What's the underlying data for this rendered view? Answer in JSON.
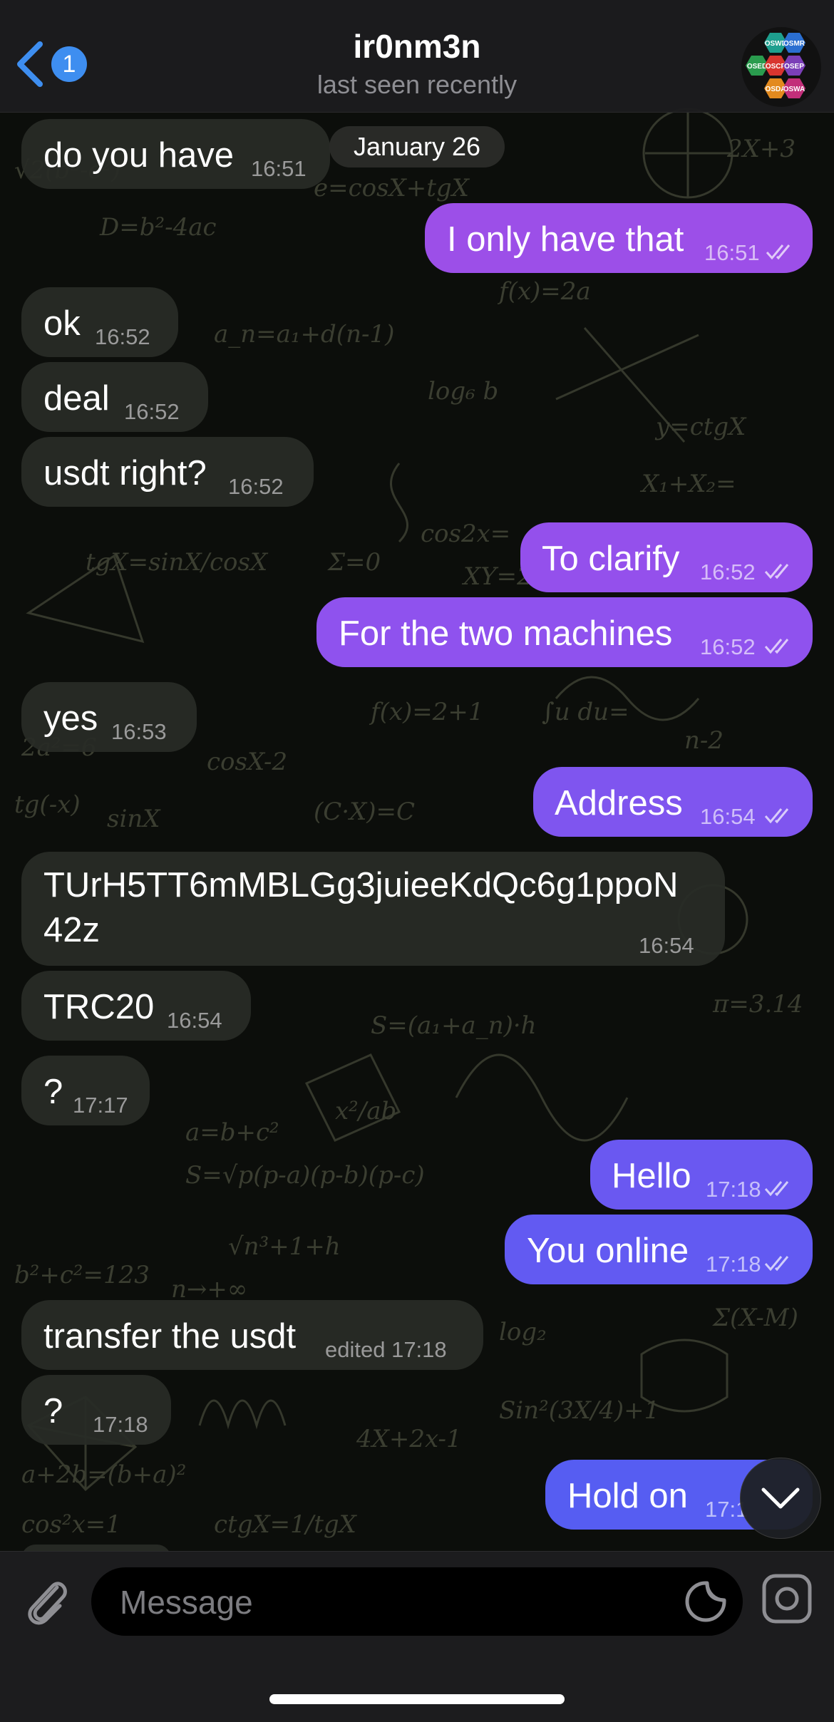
{
  "colors": {
    "accent": "#3e8ef0",
    "outgoing_top": "#9c4fe8",
    "outgoing_bottom": "#5a5cf0",
    "incoming": "#282b26",
    "header_bg": "#1c1c1e"
  },
  "header": {
    "back_badge": "1",
    "contact_name": "ir0nm3n",
    "status": "last seen recently",
    "avatar_labels": [
      "OSWE",
      "OSMR",
      "OSED",
      "OSCP",
      "OSEP",
      "OSDA",
      "OSWA"
    ]
  },
  "date_separator": "January 26",
  "messages": [
    {
      "dir": "in",
      "text": "do you have",
      "time": "16:51"
    },
    {
      "dir": "out",
      "text": "I only have that",
      "time": "16:51",
      "read": true
    },
    {
      "dir": "in",
      "text": "ok",
      "time": "16:52"
    },
    {
      "dir": "in",
      "text": "deal",
      "time": "16:52"
    },
    {
      "dir": "in",
      "text": "usdt right?",
      "time": "16:52"
    },
    {
      "dir": "out",
      "text": "To clarify",
      "time": "16:52",
      "read": true
    },
    {
      "dir": "out",
      "text": "For the two machines",
      "time": "16:52",
      "read": true
    },
    {
      "dir": "in",
      "text": "yes",
      "time": "16:53"
    },
    {
      "dir": "out",
      "text": "Address",
      "time": "16:54",
      "read": true
    },
    {
      "dir": "in",
      "text_line1": "TUrH5TT6mMBLGg3juieeKdQc6g1ppoN",
      "text_line2": "42z",
      "time": "16:54"
    },
    {
      "dir": "in",
      "text": "TRC20",
      "time": "16:54"
    },
    {
      "dir": "in",
      "text": "?",
      "time": "17:17"
    },
    {
      "dir": "out",
      "text": "Hello",
      "time": "17:18",
      "read": true
    },
    {
      "dir": "out",
      "text": "You online",
      "time": "17:18",
      "read": true
    },
    {
      "dir": "in",
      "text": "transfer the usdt",
      "time": "edited 17:18"
    },
    {
      "dir": "in",
      "text": "?",
      "time": "17:18"
    },
    {
      "dir": "out",
      "text": "Hold on",
      "time": "17:1",
      "read": true
    }
  ],
  "composer": {
    "placeholder": "Message"
  },
  "icons": [
    "chevron-left-icon",
    "paperclip-icon",
    "sticker-icon",
    "camera-icon",
    "chevron-down-icon",
    "double-check-icon"
  ]
}
